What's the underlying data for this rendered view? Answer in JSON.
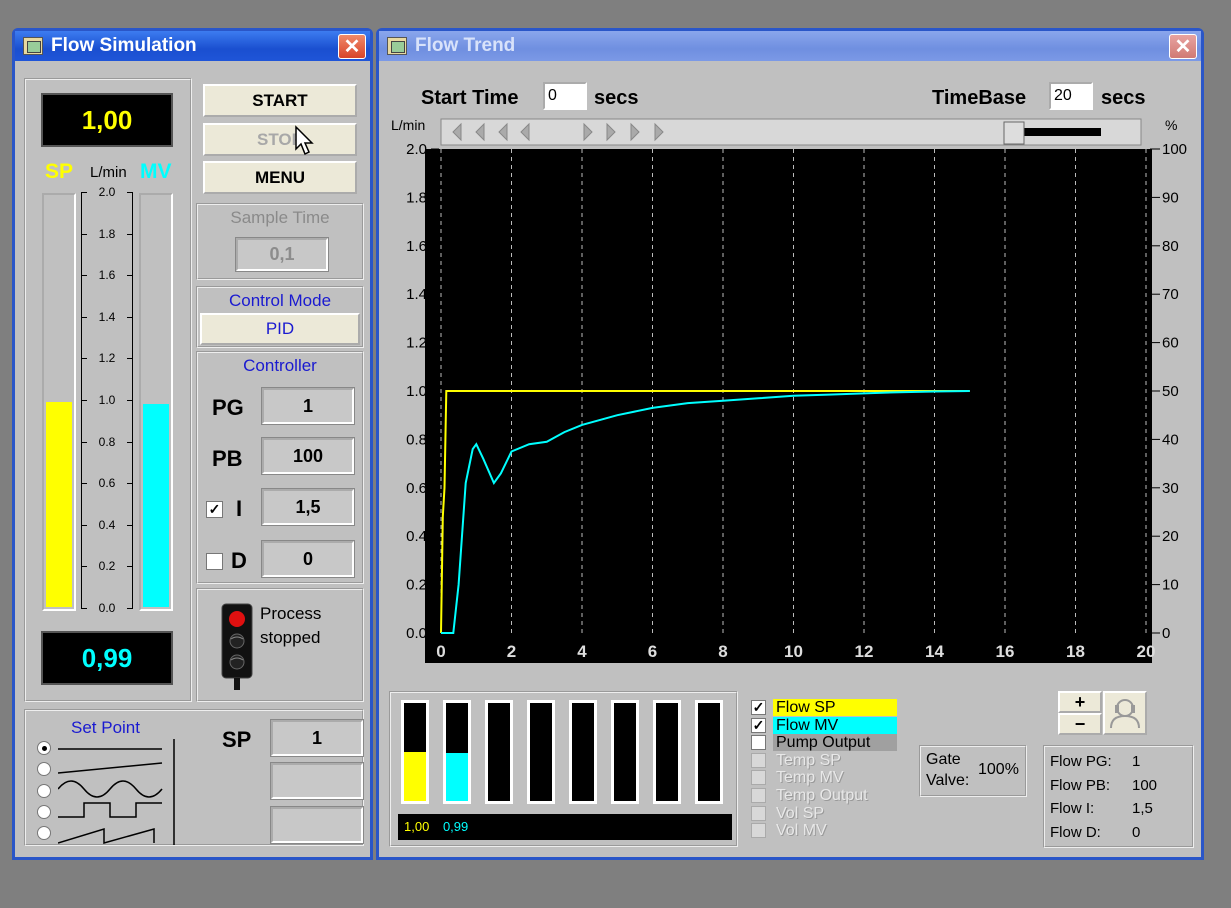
{
  "sim": {
    "title": "Flow Simulation",
    "close_label": "✕",
    "lcd_sp": "1,00",
    "lcd_mv": "0,99",
    "sp_label": "SP",
    "unit_label": "L/min",
    "mv_label": "MV",
    "sp_level": 0.5,
    "mv_level": 0.495,
    "scale_ticks": [
      "2.0",
      "1.8",
      "1.6",
      "1.4",
      "1.2",
      "1.0",
      "0.8",
      "0.6",
      "0.4",
      "0.2",
      "0.0"
    ],
    "start_label": "START",
    "stop_label": "STOP",
    "menu_label": "MENU",
    "sample_time_label": "Sample Time",
    "sample_time_value": "0,1",
    "control_mode_label": "Control Mode",
    "control_mode_value": "PID",
    "controller_label": "Controller",
    "pg_label": "PG",
    "pg_value": "1",
    "pb_label": "PB",
    "pb_value": "100",
    "i_label": "I",
    "i_value": "1,5",
    "i_checked": "✓",
    "d_label": "D",
    "d_value": "0",
    "status_text1": "Process",
    "status_text2": "stopped",
    "setpoint_label": "Set Point",
    "setpoint_sp_label": "SP",
    "setpoint_sp_value": "1",
    "setpoint_selected": 0
  },
  "trend": {
    "title": "Flow Trend",
    "close_label": "✕",
    "start_time_label": "Start Time",
    "start_time_value": "0",
    "secs1": "secs",
    "timebase_label": "TimeBase",
    "timebase_value": "20",
    "secs2": "secs",
    "left_unit": "L/min",
    "right_unit": "%",
    "bottom_sp_value": "1,00",
    "bottom_mv_value": "0,99",
    "legend": [
      {
        "label": "Flow SP",
        "checked": "✓",
        "color": "#ffff00",
        "enabled": true
      },
      {
        "label": "Flow MV",
        "checked": "✓",
        "color": "#00ffff",
        "enabled": true
      },
      {
        "label": "Pump Output",
        "checked": "",
        "color": "#a0a0a0",
        "enabled": true
      },
      {
        "label": "Temp SP",
        "checked": "",
        "color": "",
        "enabled": false
      },
      {
        "label": "Temp MV",
        "checked": "",
        "color": "",
        "enabled": false
      },
      {
        "label": "Temp Output",
        "checked": "",
        "color": "",
        "enabled": false
      },
      {
        "label": "Vol SP",
        "checked": "",
        "color": "",
        "enabled": false
      },
      {
        "label": "Vol MV",
        "checked": "",
        "color": "",
        "enabled": false
      }
    ],
    "gate_label1": "Gate",
    "gate_label2": "Valve:",
    "gate_value": "100%",
    "zoom_plus": "+",
    "zoom_minus": "−",
    "info": [
      {
        "k": "Flow PG:",
        "v": "1"
      },
      {
        "k": "Flow PB:",
        "v": "100"
      },
      {
        "k": "Flow I:",
        "v": "1,5"
      },
      {
        "k": "Flow D:",
        "v": "0"
      }
    ],
    "mini_bars": [
      {
        "level": 0.5,
        "color": "#ffff00"
      },
      {
        "level": 0.495,
        "color": "#00ffff"
      },
      {
        "level": 0,
        "color": "#a0a0a0"
      },
      {
        "level": 0,
        "color": "#a0a0a0"
      },
      {
        "level": 0,
        "color": "#a0a0a0"
      },
      {
        "level": 0,
        "color": "#a0a0a0"
      },
      {
        "level": 0,
        "color": "#a0a0a0"
      },
      {
        "level": 0,
        "color": "#a0a0a0"
      }
    ]
  },
  "chart_data": {
    "type": "line",
    "xlim": [
      0,
      20
    ],
    "ylim": [
      0,
      2.0
    ],
    "y2lim": [
      0,
      100
    ],
    "x_ticks": [
      "0",
      "2",
      "4",
      "6",
      "8",
      "10",
      "12",
      "14",
      "16",
      "18",
      "20"
    ],
    "y_ticks": [
      "0.0",
      "0.2",
      "0.4",
      "0.6",
      "0.8",
      "1.0",
      "1.2",
      "1.4",
      "1.6",
      "1.8",
      "2.0"
    ],
    "y2_ticks": [
      "0",
      "10",
      "20",
      "30",
      "40",
      "50",
      "60",
      "70",
      "80",
      "90",
      "100"
    ],
    "ylabel": "L/min",
    "y2label": "%",
    "grid": "vertical dashed",
    "background": "#000000",
    "series": [
      {
        "name": "Flow SP",
        "color": "#ffff00",
        "x": [
          0.0,
          0.05,
          0.1,
          0.15,
          0.2,
          15.0
        ],
        "y": [
          0.0,
          0.48,
          0.6,
          1.0,
          1.0,
          1.0
        ]
      },
      {
        "name": "Flow MV",
        "color": "#00ffff",
        "x": [
          0.0,
          0.35,
          0.5,
          0.7,
          0.9,
          1.0,
          1.2,
          1.5,
          1.7,
          2.0,
          2.5,
          3.0,
          3.5,
          4.0,
          5.0,
          6.0,
          7.0,
          8.0,
          9.0,
          10.0,
          11.0,
          12.0,
          13.0,
          14.0,
          15.0
        ],
        "y": [
          0.0,
          0.0,
          0.2,
          0.62,
          0.76,
          0.78,
          0.72,
          0.62,
          0.66,
          0.75,
          0.78,
          0.79,
          0.83,
          0.86,
          0.9,
          0.93,
          0.95,
          0.96,
          0.97,
          0.98,
          0.985,
          0.99,
          0.995,
          0.998,
          1.0
        ]
      }
    ]
  }
}
